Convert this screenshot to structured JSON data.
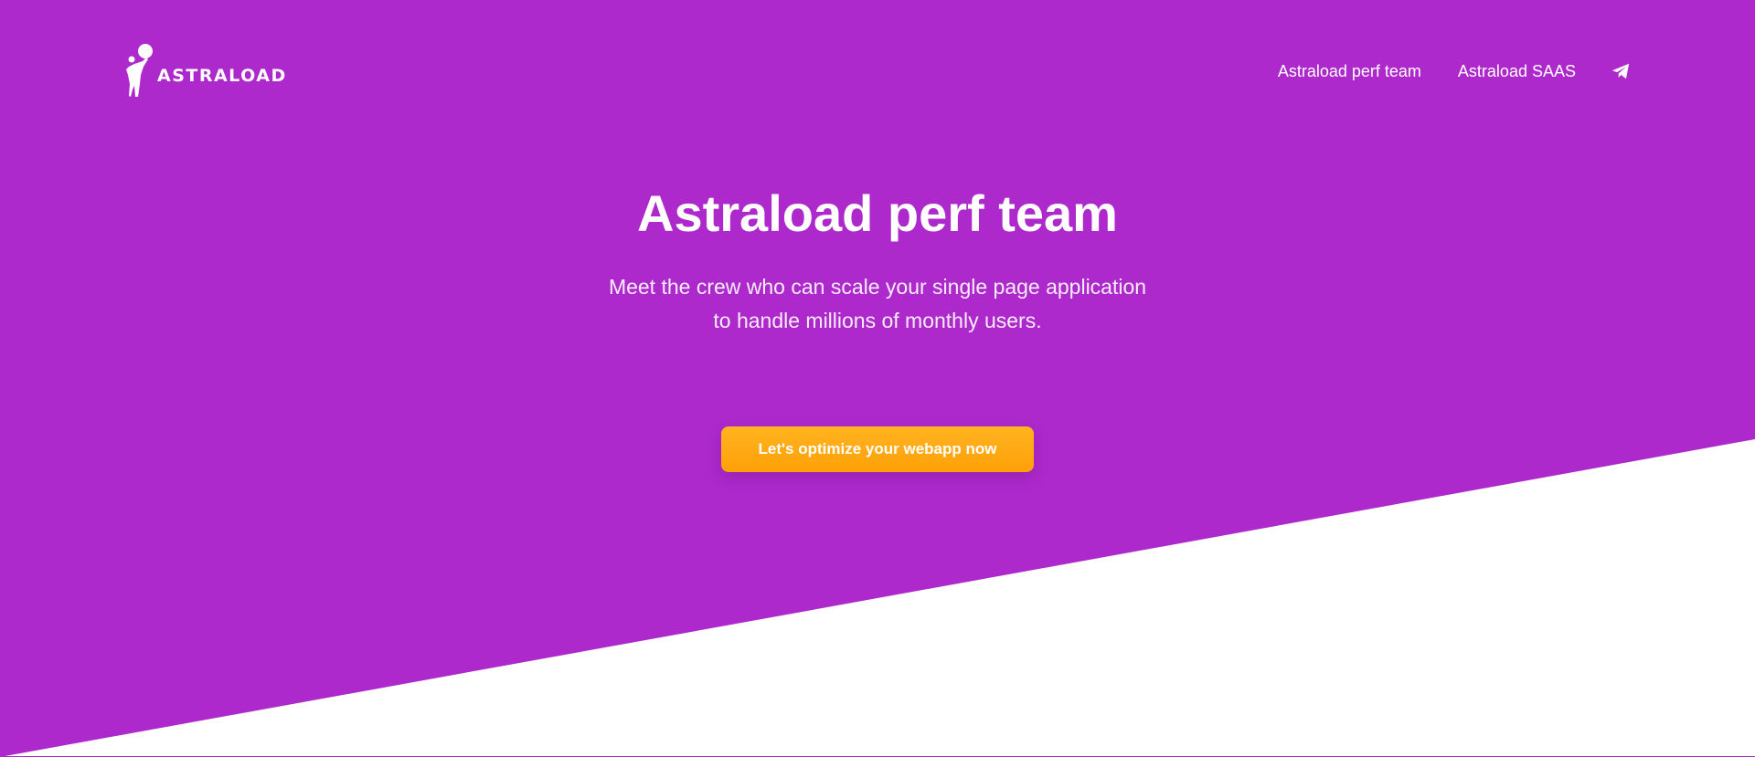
{
  "brand": {
    "name": "ASTRALOAD",
    "logo_icon": "astronaut-holding-ball-icon"
  },
  "nav": {
    "links": [
      {
        "label": "Astraload perf team"
      },
      {
        "label": "Astraload SAAS"
      }
    ],
    "contact_icon": "paper-plane-icon"
  },
  "hero": {
    "title": "Astraload perf team",
    "subtitle_lines": [
      "Meet the crew who can scale your single page application",
      "to handle millions of monthly users."
    ],
    "cta_label": "Let's optimize your webapp now"
  },
  "colors": {
    "background_purple": "#ad29cc",
    "background_white": "#ffffff",
    "cta_orange": "#ffa70f",
    "text_white": "#ffffff"
  }
}
